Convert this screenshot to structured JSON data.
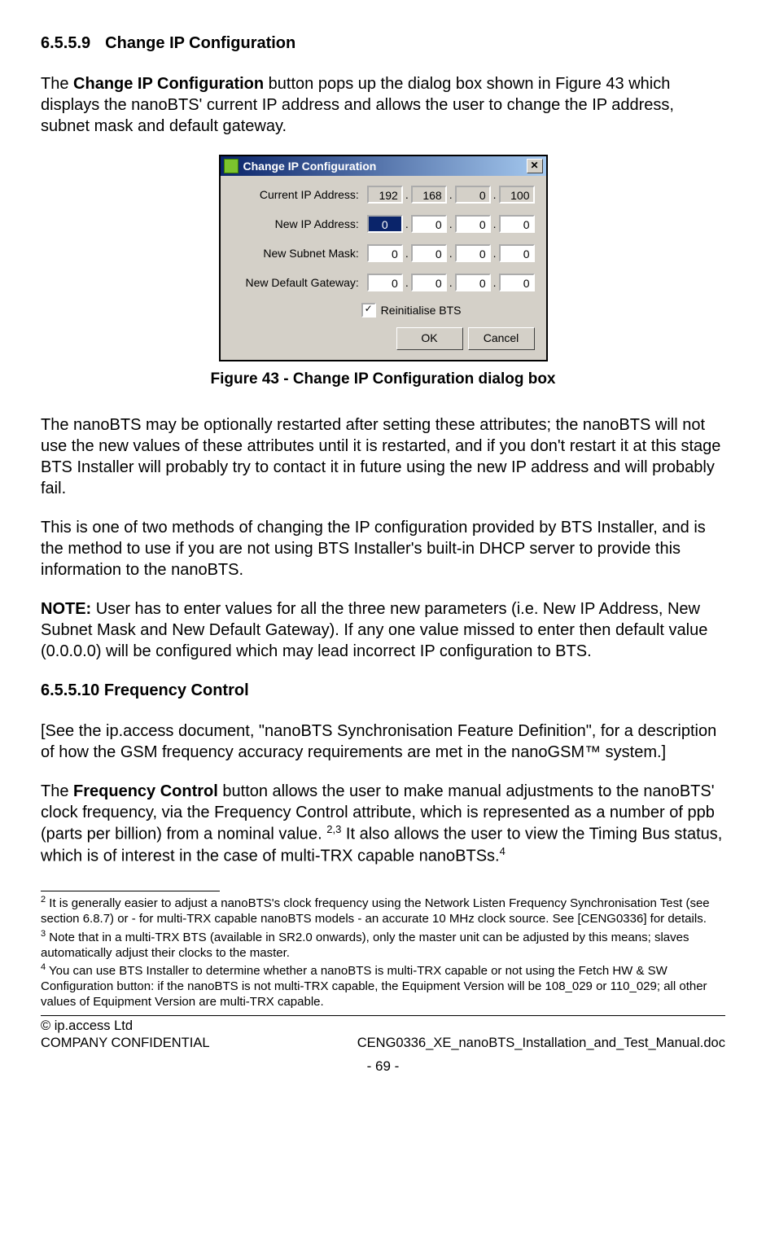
{
  "section1": {
    "number": "6.5.5.9",
    "title": "Change IP Configuration"
  },
  "para1_a": "The ",
  "para1_b": "Change IP Configuration",
  "para1_c": " button pops up the dialog box shown in Figure 43 which displays the nanoBTS' current IP address and allows the user to change the IP address, subnet mask and default gateway.",
  "dialog": {
    "title": "Change IP Configuration",
    "close": "✕",
    "rows": [
      {
        "label": "Current IP Address:",
        "octets": [
          "192",
          "168",
          "0",
          "100"
        ],
        "readonly": true,
        "selected": -1
      },
      {
        "label": "New IP Address:",
        "octets": [
          "0",
          "0",
          "0",
          "0"
        ],
        "readonly": false,
        "selected": 0
      },
      {
        "label": "New Subnet Mask:",
        "octets": [
          "0",
          "0",
          "0",
          "0"
        ],
        "readonly": false,
        "selected": -1
      },
      {
        "label": "New Default Gateway:",
        "octets": [
          "0",
          "0",
          "0",
          "0"
        ],
        "readonly": false,
        "selected": -1
      }
    ],
    "checkbox_label": "Reinitialise BTS",
    "checkbox_mark": "✓",
    "ok": "OK",
    "cancel": "Cancel"
  },
  "caption": "Figure 43 - Change IP Configuration dialog box",
  "para2": "The nanoBTS may be optionally restarted after setting these attributes; the nanoBTS will not use the new values of these attributes until it is restarted, and if you don't restart it at this stage BTS Installer will probably try to contact it in future using the new IP address and will probably fail.",
  "para3": "This is one of two methods of changing the IP configuration provided by BTS Installer, and is the method to use if you are not using BTS Installer's built-in DHCP server to provide this information to the nanoBTS.",
  "note_label": "NOTE:",
  "note_body": " User has to enter values for all the three new parameters (i.e. New IP Address, New Subnet Mask and New Default Gateway). If any one value missed to enter then default value (0.0.0.0) will be configured which may lead incorrect IP configuration to BTS.",
  "section2": {
    "number": "6.5.5.10",
    "title": "Frequency Control"
  },
  "para4": "[See the ip.access document, \"nanoBTS Synchronisation Feature Definition\", for a description of how the GSM frequency accuracy requirements are met in the nanoGSM™ system.]",
  "para5_a": "The ",
  "para5_b": "Frequency Control",
  "para5_c": " button allows the user to make manual adjustments to the nanoBTS' clock frequency, via the Frequency Control attribute, which is represented as a number of ppb (parts per billion) from a nominal value. ",
  "para5_ref1": "2,3",
  "para5_d": " It also allows the user to view the Timing Bus status, which is of interest in the case of multi-TRX capable nanoBTSs.",
  "para5_ref2": "4",
  "footnotes": {
    "f2_num": "2",
    "f2": " It is generally easier to adjust a nanoBTS's clock frequency using the Network Listen Frequency Synchronisation Test (see section 6.8.7) or - for multi-TRX capable nanoBTS models - an accurate 10 MHz clock source. See [CENG0336] for details.",
    "f3_num": "3",
    "f3": " Note that in a multi-TRX BTS (available in SR2.0 onwards), only the master unit can be adjusted by this means; slaves automatically adjust their clocks to the master.",
    "f4_num": "4",
    "f4": " You can use BTS Installer to determine whether a nanoBTS is multi-TRX capable or not using the Fetch HW & SW Configuration button: if the nanoBTS is not multi-TRX capable, the Equipment Version will be 108_029 or 110_029; all other values of Equipment Version are multi-TRX capable."
  },
  "footer": {
    "copyright": "© ip.access Ltd",
    "left": "COMPANY CONFIDENTIAL",
    "right": "CENG0336_XE_nanoBTS_Installation_and_Test_Manual.doc",
    "page": "- 69 -"
  }
}
